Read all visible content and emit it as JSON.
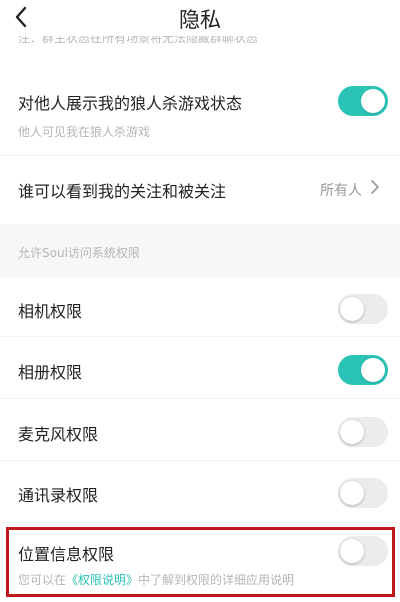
{
  "header": {
    "title": "隐私"
  },
  "top_note": "注：群主状态在所有场景将无法隐藏群聊状态",
  "werewolf": {
    "label": "对他人展示我的狼人杀游戏状态",
    "sub": "他人可见我在狼人杀游戏",
    "enabled": true
  },
  "visibility": {
    "label": "谁可以看到我的关注和被关注",
    "value": "所有人"
  },
  "section_title": "允许Soul访问系统权限",
  "permissions": [
    {
      "label": "相机权限",
      "enabled": false
    },
    {
      "label": "相册权限",
      "enabled": true
    },
    {
      "label": "麦克风权限",
      "enabled": false
    },
    {
      "label": "通讯录权限",
      "enabled": false
    },
    {
      "label": "位置信息权限",
      "enabled": false
    }
  ],
  "location_note": {
    "before": "您可以在",
    "link": "《权限说明》",
    "after": "中了解到权限的详细应用说明"
  },
  "colors": {
    "accent": "#2ac3b6",
    "highlight": "#c0171a",
    "toggle_off": "#ececec"
  },
  "icons": {
    "back": "chevron-left-icon",
    "more": "chevron-right-icon"
  }
}
